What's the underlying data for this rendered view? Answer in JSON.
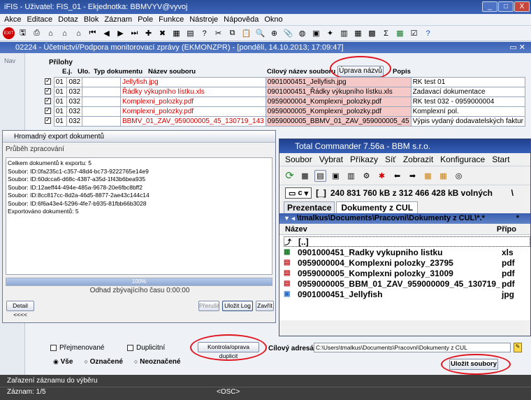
{
  "titlebar": {
    "title": "iFIS - Uživatel: FIS_01 - Ekjednotka: BBMVYV@vyvoj",
    "min": "_",
    "max": "□",
    "close": "X"
  },
  "menubar": [
    "Akce",
    "Editace",
    "Dotaz",
    "Blok",
    "Záznam",
    "Pole",
    "Funkce",
    "Nástroje",
    "Nápověda",
    "Okno"
  ],
  "form_title": "02224 - Účetnictví/Podpora monitorovací zprávy (EKMONZPR) - [pondělí, 14.10.2013; 17:09:47]",
  "left_nav": "Nav",
  "attachments": {
    "section_label": "Přílohy",
    "headers": {
      "ej": "E.j.",
      "ulo": "Ulo.",
      "typ": "Typ dokumentu",
      "nazev": "Název souboru",
      "cilovy": "Cílový název souboru",
      "popis": "Popis"
    },
    "rename_button": "Úprava názvů",
    "rows": [
      {
        "ej": "01",
        "ulo": "082",
        "typ": "",
        "nazev": "Jellyfish.jpg",
        "cilovy": "0901000451_Jellyfish.jpg",
        "popis": "RK test 01"
      },
      {
        "ej": "01",
        "ulo": "032",
        "typ": "",
        "nazev": "Řádky výkupního lístku.xls",
        "cilovy": "0901000451_Řádky výkupního lístku.xls",
        "popis": "Zadavací dokumentace"
      },
      {
        "ej": "01",
        "ulo": "032",
        "typ": "",
        "nazev": "Komplexni_polozky.pdf",
        "cilovy": "0959000004_Komplexni_polozky.pdf",
        "popis": "RK test 032 - 0959000004"
      },
      {
        "ej": "01",
        "ulo": "032",
        "typ": "",
        "nazev": "Komplexni_polozky.pdf",
        "cilovy": "0959000005_Komplexni_polozky.pdf",
        "popis": "Komplexní pol."
      },
      {
        "ej": "01",
        "ulo": "032",
        "typ": "",
        "nazev": "BBMV_01_ZAV_959000005_45_130719_143",
        "cilovy": "0959000005_BBMV_01_ZAV_959000005_45",
        "popis": "Výpis vydaný dodavatelských faktur"
      }
    ]
  },
  "export_dialog": {
    "title": "Hromadný export dokumentů",
    "section": "Průběh zpracování",
    "log": [
      "Celkem dokumentů k exportu: 5",
      "Soubor: ID:0fa235c1-c357-48d4-bc73-9222765e14e9",
      "Soubor: ID:60dcca6-d68c-4387-a35d-1f43b6bea935",
      "Soubor: ID:12aeff44-494e-485a-9678-20e6fbc8bff2",
      "Soubor: ID:8cc817cc-8d2a-46d5-8877-2ae43c144c14",
      "Soubor: ID:6f6a43e4-5296-4fe7-b935-81fbb66b3028",
      "Exportováno dokumentů: 5"
    ],
    "progress_text": "100%",
    "progress": 1.0,
    "remaining": "Odhad zbývajícího času 0:00:00",
    "detail_button": "Detail <<<<",
    "interrupt_button": "Přerušit",
    "save_log_button": "Uložit Log",
    "close_button": "Zavřít"
  },
  "total_commander": {
    "title": "Total Commander 7.56a - BBM s.r.o.",
    "menu": [
      "Soubor",
      "Vybrat",
      "Příkazy",
      "Síť",
      "Zobrazit",
      "Konfigurace",
      "Start"
    ],
    "drive": "c",
    "drive_label": "[_]",
    "free_space": "240 831 760 kB z 312 466 428 kB volných",
    "backslash": "\\",
    "tabs": [
      "Prezentace",
      "Dokumenty z CUL"
    ],
    "path": "\\tmalkus\\Documents\\Pracovni\\Dokumenty z CUL\\*.*",
    "path_star": "*",
    "col_name": "Název",
    "col_ext": "Přípo",
    "files": [
      {
        "name": "[..]",
        "ext": "",
        "icon": "folder-up"
      },
      {
        "name": "0901000451_Radky vykupniho listku",
        "ext": "xls",
        "icon": "excel"
      },
      {
        "name": "0959000004_Komplexni polozky_23795",
        "ext": "pdf",
        "icon": "pdf"
      },
      {
        "name": "0959000005_Komplexni polozky_31009",
        "ext": "pdf",
        "icon": "pdf"
      },
      {
        "name": "0959000005_BBM_01_ZAV_959000009_45_130719_1",
        "ext": "pdf",
        "icon": "pdf"
      },
      {
        "name": "0901000451_Jellyfish",
        "ext": "jpg",
        "icon": "image"
      }
    ]
  },
  "bottom": {
    "prejmenovane": "Přejmenované",
    "duplicitni": "Duplicitní",
    "vse": "Vše",
    "oznacene": "Označené",
    "neoznacene": "Neoznačené",
    "duplicate_button": "Kontrola/oprava duplicit",
    "target_label": "Cílový adresář",
    "target_path": "C:\\Users\\tmalkus\\Documents\\Pracovni\\Dokumenty z CUL",
    "save_button": "Uložit soubory"
  },
  "status": {
    "message": "Zařazení záznamu do výběru",
    "record": "Záznam: 1/5",
    "osc": "<OSC>"
  }
}
